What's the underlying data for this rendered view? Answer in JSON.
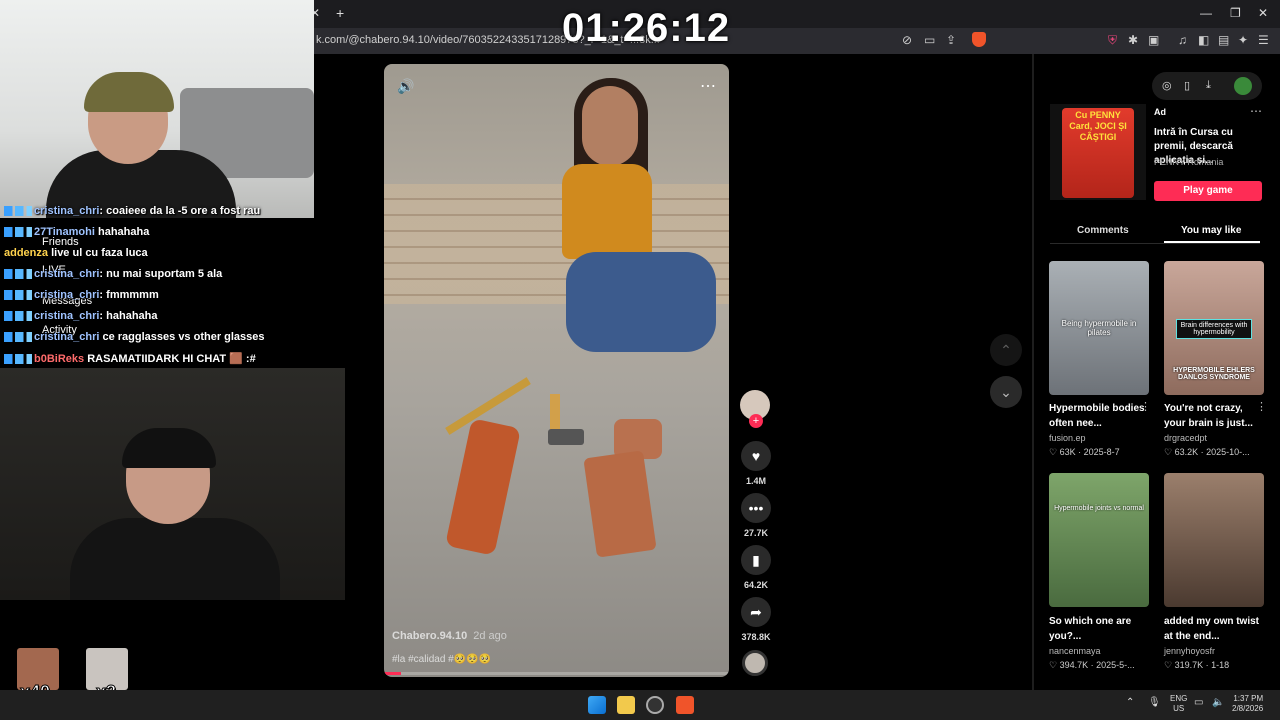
{
  "timer": "01:26:12",
  "browser": {
    "url": "k.com/@chabero.94.10/video/7603522433517128978?_r=1&_t=...3k..."
  },
  "chat": {
    "messages": [
      {
        "user": "cristina_chri",
        "text": "coaieee da la -5 ore a fost rau"
      },
      {
        "user": "27Tinamohi",
        "text": "hahahaha"
      },
      {
        "user": "addenza",
        "text": "live ul cu faza luca"
      },
      {
        "user": "cristina_chri",
        "text": "nu mai suportam 5 ala"
      },
      {
        "user": "cristina_chri",
        "text": "fmmmmm"
      },
      {
        "user": "cristina_chri",
        "text": "hahahaha"
      },
      {
        "user": "cristina_chri",
        "text": "ce ragglasses vs other glasses"
      },
      {
        "user": "b0BiReks",
        "text": "RASAMATIIDARK HI CHAT 🟫 :#"
      }
    ],
    "side_labels": [
      "Friends",
      "LIVE",
      "Messages",
      "Activity"
    ]
  },
  "emotes": [
    {
      "count": "x40"
    },
    {
      "count": "x3"
    }
  ],
  "video": {
    "author": "Chabero.94.10",
    "time_ago": "2d ago",
    "caption": "#la #calidad #🥺🥺🥺",
    "progress": 0.05
  },
  "actions": {
    "likes": "1.4M",
    "comments": "27.7K",
    "saves": "64.2K",
    "shares": "378.8K"
  },
  "ad": {
    "card_text": "Cu PENNY Card, JOCI ȘI CÂȘTIGI",
    "label": "Ad",
    "title": "Intră în Cursa cu premii, descarcă aplicația și...",
    "brand": "PENNY Romania",
    "cta": "Play game"
  },
  "tabs": {
    "comments": "Comments",
    "you_may_like": "You may like",
    "active": "You may like"
  },
  "cards": [
    {
      "thumb_text": "Being hypermobile in pilates",
      "title": "Hypermobile bodies often nee...",
      "user": "fusion.ep",
      "likes": "63K",
      "date": "2025-8-7"
    },
    {
      "thumb_text": "Brain differences with hypermobility",
      "thumb_text2": "HYPERMOBILE EHLERS DANLOS SYNDROME",
      "title": "You're not crazy, your brain is just...",
      "user": "drgracedpt",
      "likes": "63.2K",
      "date": "2025-10-..."
    },
    {
      "thumb_text": "Hypermobile joints vs normal",
      "title": "So which one are you?...",
      "user": "nancenmaya",
      "likes": "394.7K",
      "date": "2025-5-..."
    },
    {
      "thumb_text": "",
      "title": "added my own twist at the end...",
      "user": "jennyhoyosfr",
      "likes": "319.7K",
      "date": "1-18"
    }
  ],
  "taskbar": {
    "lang": "ENG",
    "region": "US",
    "time": "1:37 PM",
    "date": "2/8/2026"
  },
  "colors": {
    "accent": "#fe2c55",
    "panel_bg": "#000000",
    "taskbar_bg": "#202020"
  }
}
